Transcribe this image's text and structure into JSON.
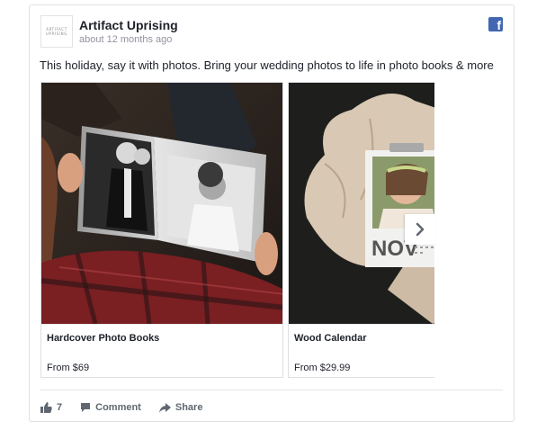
{
  "post": {
    "page_name": "Artifact Uprising",
    "avatar_text": "ARTIFACT UPRISING",
    "timestamp": "about 12 months ago",
    "message": "This holiday, say it with photos. Bring your wedding photos to life in photo books & more"
  },
  "carousel": {
    "slides": [
      {
        "title": "Hardcover Photo Books",
        "price": "From $69"
      },
      {
        "title": "Wood Calendar",
        "price": "From $29.99"
      }
    ],
    "calendar_month": "NOV"
  },
  "actions": {
    "like_count": "7",
    "comment_label": "Comment",
    "share_label": "Share"
  },
  "colors": {
    "facebook_blue": "#4267b2",
    "action_gray": "#606770",
    "timestamp_gray": "#90949c"
  }
}
